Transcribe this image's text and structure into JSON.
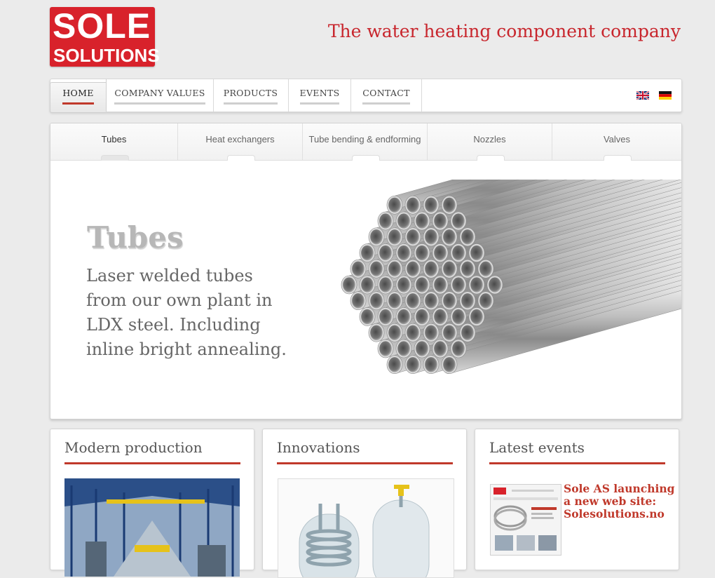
{
  "brand": {
    "logo_line1": "SOLE",
    "logo_line2": "SOLUTIONS",
    "tagline": "The water heating component company",
    "accent_color": "#c8262d"
  },
  "nav": {
    "items": [
      {
        "label": "HOME",
        "active": true
      },
      {
        "label": "COMPANY VALUES"
      },
      {
        "label": "PRODUCTS"
      },
      {
        "label": "EVENTS"
      },
      {
        "label": "CONTACT"
      }
    ],
    "languages": [
      "uk-flag-icon",
      "germany-flag-icon"
    ]
  },
  "slider": {
    "tabs": [
      {
        "label": "Tubes",
        "active": true
      },
      {
        "label": "Heat exchangers"
      },
      {
        "label": "Tube bending & endforming"
      },
      {
        "label": "Nozzles"
      },
      {
        "label": "Valves"
      }
    ],
    "title": "Tubes",
    "text": "Laser welded tubes from our own plant in LDX steel. Including inline bright annealing."
  },
  "cards": [
    {
      "title": "Modern production"
    },
    {
      "title": "Innovations"
    },
    {
      "title": "Latest events",
      "event_title": "Sole AS launching a new web site: Solesolutions.no"
    }
  ]
}
